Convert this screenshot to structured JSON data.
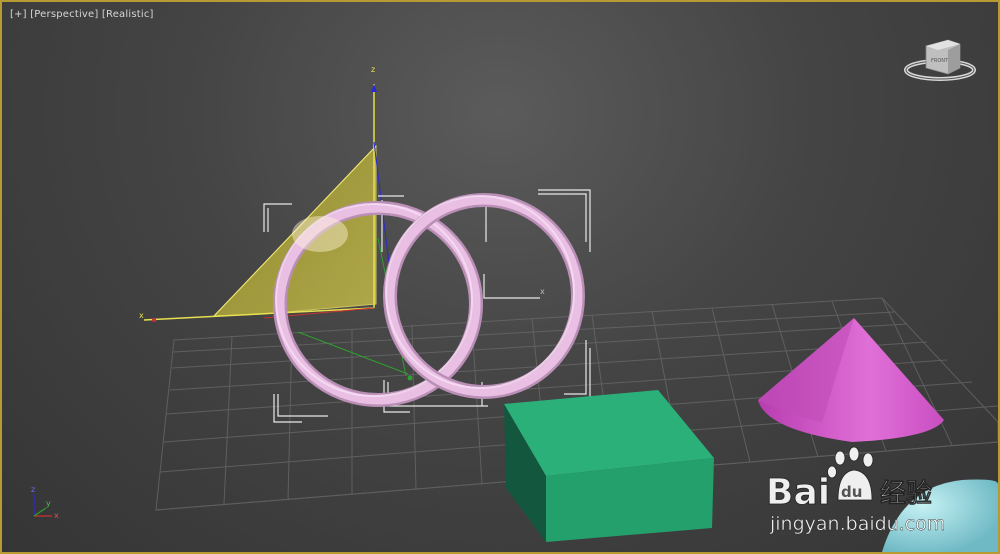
{
  "viewport": {
    "labels": {
      "plus": "[+]",
      "view": "[Perspective]",
      "shading": "[Realistic]"
    },
    "viewcube_face": "FRONT"
  },
  "gizmo": {
    "axis_x": "x",
    "axis_y": "y",
    "axis_z": "z"
  },
  "corner_axes": {
    "axis_x": "x",
    "axis_y": "y",
    "axis_z": "z"
  },
  "watermark": {
    "brand_prefix": "Bai",
    "brand_suffix": "du",
    "product": "经验",
    "url": "jingyan.baidu.com"
  },
  "colors": {
    "selection_border": "#b89a33",
    "torus": "#e6b8e0",
    "cone": "#d55ccc",
    "box": "#26a571",
    "plane": "#c9c04a",
    "axis_x": "#c83232",
    "axis_y": "#2ea02e",
    "axis_z": "#2a2ad0"
  }
}
